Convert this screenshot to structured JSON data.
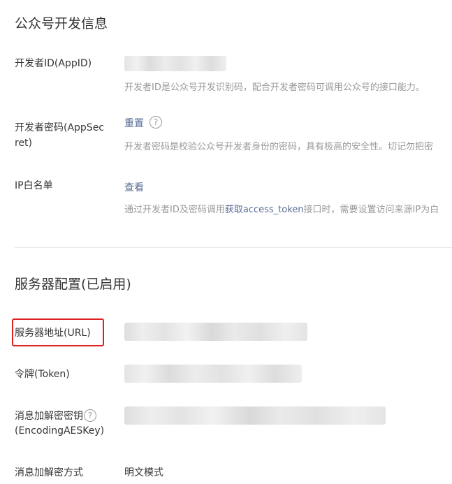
{
  "dev_info": {
    "title": "公众号开发信息",
    "app_id": {
      "label": "开发者ID(AppID)",
      "desc": "开发者ID是公众号开发识别码，配合开发者密码可调用公众号的接口能力。"
    },
    "app_secret": {
      "label": "开发者密码(AppSecret)",
      "action": "重置",
      "desc": "开发者密码是校验公众号开发者身份的密码，具有极高的安全性。切记勿把密"
    },
    "ip_whitelist": {
      "label": "IP白名单",
      "action": "查看",
      "desc_before": "通过开发者ID及密码调用",
      "desc_link": "获取access_token",
      "desc_after": "接口时，需要设置访问来源IP为白"
    }
  },
  "server_config": {
    "title": "服务器配置(已启用)",
    "url": {
      "label": "服务器地址(URL)"
    },
    "token": {
      "label": "令牌(Token)"
    },
    "aes_key": {
      "label_line1": "消息加解密密钥",
      "label_line2": "(EncodingAESKey)"
    },
    "encrypt_mode": {
      "label": "消息加解密方式",
      "value": "明文模式"
    }
  },
  "icons": {
    "help": "question-circle-icon"
  },
  "colors": {
    "link": "#576b95",
    "highlight_box": "#e02020",
    "desc_text": "#9a9a9a"
  }
}
